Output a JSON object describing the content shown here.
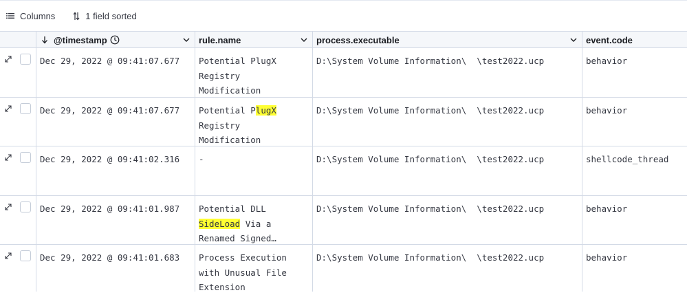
{
  "toolbar": {
    "columns_label": "Columns",
    "sort_label": "1 field sorted"
  },
  "columns": {
    "timestamp": "@timestamp",
    "rule_name": "rule.name",
    "process_executable": "process.executable",
    "event_code": "event.code"
  },
  "rows": [
    {
      "timestamp": "Dec 29, 2022 @ 09:41:07.677",
      "rule_name": "Potential PlugX\nRegistry\nModification",
      "process_executable": "D:\\System Volume Information\\  \\test2022.ucp",
      "event_code": "behavior"
    },
    {
      "timestamp": "Dec 29, 2022 @ 09:41:07.677",
      "rule_name_a": "Potential P",
      "rule_name_b": "lugX",
      "rule_name_c": "\nRegistry\nModification",
      "process_executable": "D:\\System Volume Information\\  \\test2022.ucp",
      "event_code": "behavior"
    },
    {
      "timestamp": "Dec 29, 2022 @ 09:41:02.316",
      "rule_name": "-",
      "process_executable": "D:\\System Volume Information\\  \\test2022.ucp",
      "event_code": "shellcode_thread"
    },
    {
      "timestamp": "Dec 29, 2022 @ 09:41:01.987",
      "rule_name_a": "Potential",
      "rule_name_b": " DLL\n",
      "rule_name_c": "SideLoad",
      "rule_name_d": " Via a\nRenamed Signed…",
      "process_executable": "D:\\System Volume Information\\  \\test2022.ucp",
      "event_code": "behavior"
    },
    {
      "timestamp": "Dec 29, 2022 @ 09:41:01.683",
      "rule_name": "Process Execution\nwith Unusual File\nExtension",
      "process_executable": "D:\\System Volume Information\\  \\test2022.ucp",
      "event_code": "behavior"
    }
  ]
}
